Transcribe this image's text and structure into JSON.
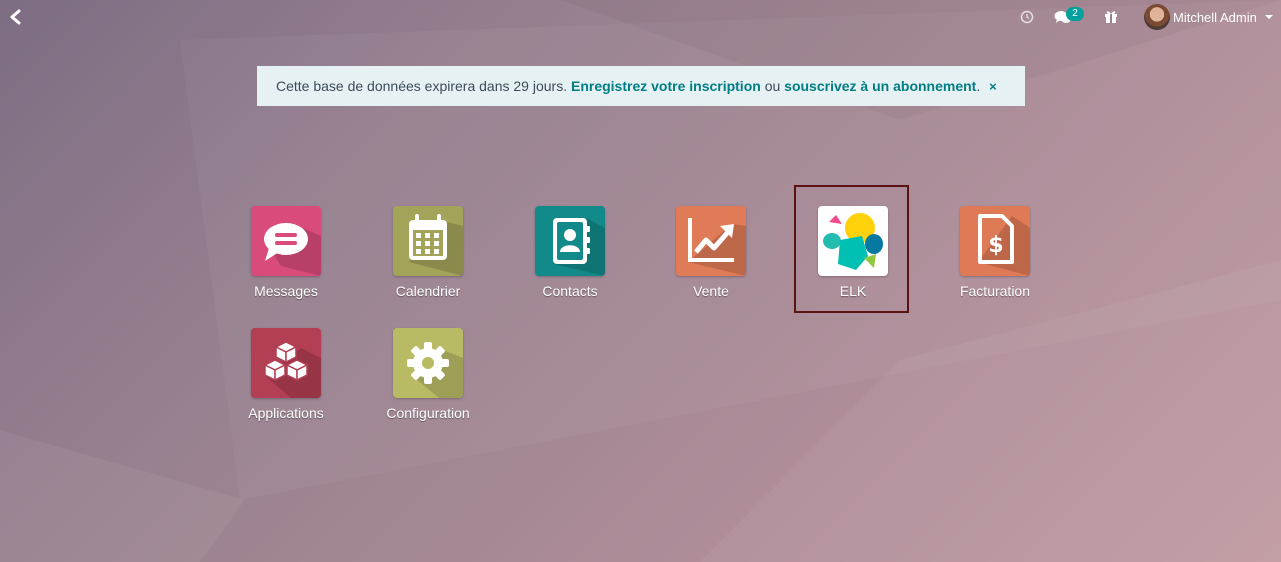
{
  "topbar": {
    "activity_icon": "clock-icon",
    "messages_icon": "chat-bubbles-icon",
    "messages_count": "2",
    "gift_icon": "gift-icon",
    "user_name": "Mitchell Admin"
  },
  "notice": {
    "text": "Cette base de données expirera dans 29 jours.",
    "register_link": "Enregistrez votre inscription",
    "connector": "ou",
    "subscribe_link": "souscrivez à un abonnement",
    "period": ".",
    "close": "×"
  },
  "apps": [
    {
      "label": "Messages",
      "icon": "chat-icon",
      "color": "#d94b7b"
    },
    {
      "label": "Calendrier",
      "icon": "calendar-icon",
      "color": "#a3a35a"
    },
    {
      "label": "Contacts",
      "icon": "address-book-icon",
      "color": "#128a89"
    },
    {
      "label": "Vente",
      "icon": "trend-up-icon",
      "color": "#e07b57"
    },
    {
      "label": "ELK",
      "icon": "elastic-logo-icon",
      "color": "#ffffff"
    },
    {
      "label": "Facturation",
      "icon": "invoice-dollar-icon",
      "color": "#de7a55"
    },
    {
      "label": "Applications",
      "icon": "cubes-icon",
      "color": "#b23f54"
    },
    {
      "label": "Configuration",
      "icon": "gear-icon",
      "color": "#b8bb64"
    }
  ]
}
